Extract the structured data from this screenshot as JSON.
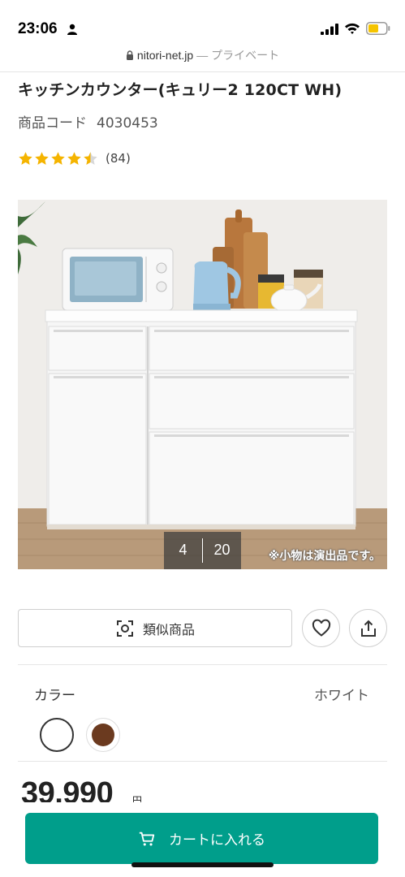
{
  "status_bar": {
    "time": "23:06",
    "icons": [
      "person-icon",
      "signal-icon",
      "wifi-icon",
      "battery-icon"
    ],
    "battery_color": "#f5c400"
  },
  "browser": {
    "host": "nitori-net.jp",
    "mode": "— プライベート",
    "icon": "lock-icon"
  },
  "product": {
    "title": "キッチンカウンター(キュリー2 120CT WH)",
    "code_label": "商品コード",
    "code": "4030453",
    "rating": 4.5,
    "star_color": "#f5b400",
    "review_count": "(84)"
  },
  "gallery": {
    "current": "4",
    "total": "20",
    "note": "※小物は演出品です。"
  },
  "actions": {
    "similar_label": "類似商品",
    "similar_icon": "scan-icon",
    "favorite_icon": "heart-icon",
    "share_icon": "share-icon"
  },
  "color": {
    "label": "カラー",
    "selected": "ホワイト",
    "swatches": [
      {
        "name": "white",
        "hex": "#ffffff"
      },
      {
        "name": "brown",
        "hex": "#6b3a1f"
      }
    ]
  },
  "price": {
    "value": "39,990",
    "unit": "円"
  },
  "cart": {
    "label": "カートに入れる",
    "icon": "cart-icon",
    "color": "#009e8b"
  }
}
